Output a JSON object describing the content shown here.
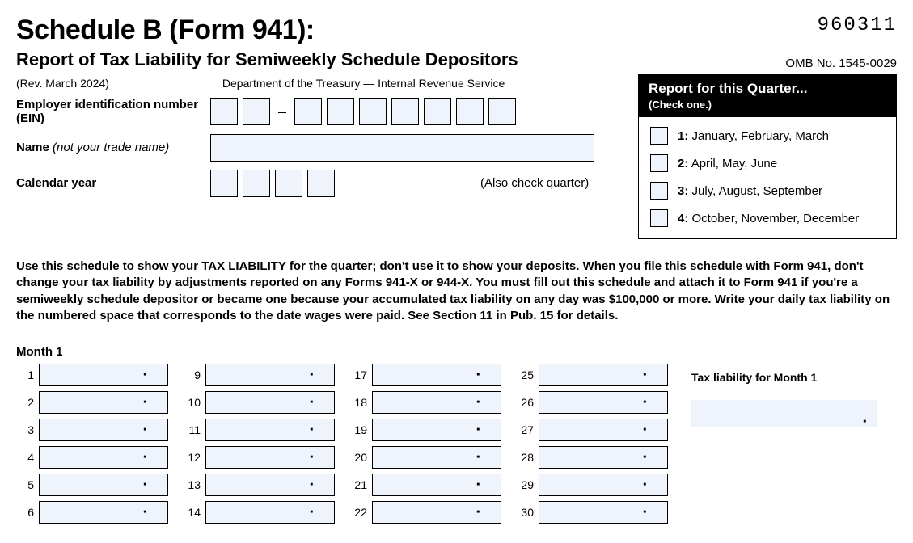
{
  "form_code": "960311",
  "title": "Schedule B (Form 941):",
  "subtitle": "Report of Tax Liability for Semiweekly Schedule Depositors",
  "omb": "OMB No. 1545-0029",
  "revision": "(Rev. March 2024)",
  "department": "Department of the Treasury — Internal Revenue Service",
  "labels": {
    "ein_line1": "Employer identification number",
    "ein_line2": "(EIN)",
    "name": "Name",
    "name_note": "(not your trade name)",
    "year": "Calendar year",
    "also_check": "(Also check quarter)"
  },
  "quarter_box": {
    "heading": "Report for this Quarter...",
    "sub": "(Check one.)",
    "options": [
      {
        "num": "1:",
        "text": "January, February, March"
      },
      {
        "num": "2:",
        "text": "April, May, June"
      },
      {
        "num": "3:",
        "text": "July, August, September"
      },
      {
        "num": "4:",
        "text": "October, November, December"
      }
    ]
  },
  "instructions": "Use this schedule to show your TAX LIABILITY for the quarter; don't use it to show your deposits. When you file this schedule with Form 941, don't change your tax liability by adjustments reported on any Forms 941-X or 944-X. You must fill out this schedule and attach it to Form 941 if you're a semiweekly schedule depositor or became one because your accumulated tax liability on any day was $100,000 or more. Write your daily tax liability on the numbered space that corresponds to the date wages were paid. See Section 11 in Pub. 15 for details.",
  "month1_label": "Month 1",
  "month1_total_label": "Tax liability for Month 1",
  "days": {
    "col1": [
      "1",
      "2",
      "3",
      "4",
      "5",
      "6"
    ],
    "col2": [
      "9",
      "10",
      "11",
      "12",
      "13",
      "14"
    ],
    "col3": [
      "17",
      "18",
      "19",
      "20",
      "21",
      "22"
    ],
    "col4": [
      "25",
      "26",
      "27",
      "28",
      "29",
      "30"
    ]
  }
}
